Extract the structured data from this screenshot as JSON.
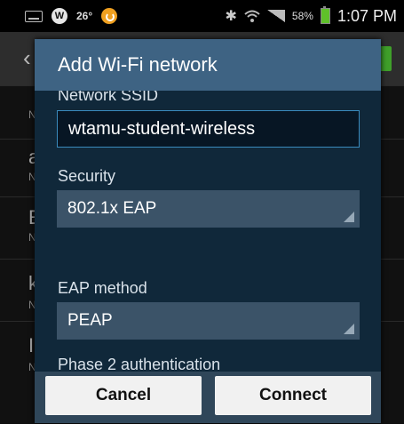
{
  "status_bar": {
    "weather_temp": "26°",
    "battery_percent": "58%",
    "time": "1:07 PM",
    "icons": [
      "keyboard-icon",
      "w-badge-icon",
      "orange-app-icon",
      "bluetooth-icon",
      "wifi-icon",
      "signal-icon",
      "battery-icon"
    ],
    "battery_color": "#5fc12a"
  },
  "background": {
    "letters": [
      "a",
      "E",
      "k",
      "I"
    ],
    "sub_letter": "N",
    "bottom_text": "m"
  },
  "dialog": {
    "title": "Add Wi-Fi network",
    "ssid_label": "Network SSID",
    "ssid_value": "wtamu-student-wireless",
    "security_label": "Security",
    "security_value": "802.1x EAP",
    "eap_label": "EAP method",
    "eap_value": "PEAP",
    "phase2_label": "Phase 2 authentication",
    "cancel_label": "Cancel",
    "connect_label": "Connect",
    "title_bar_color": "#3e6383",
    "input_border_color": "#3a8bbd"
  }
}
